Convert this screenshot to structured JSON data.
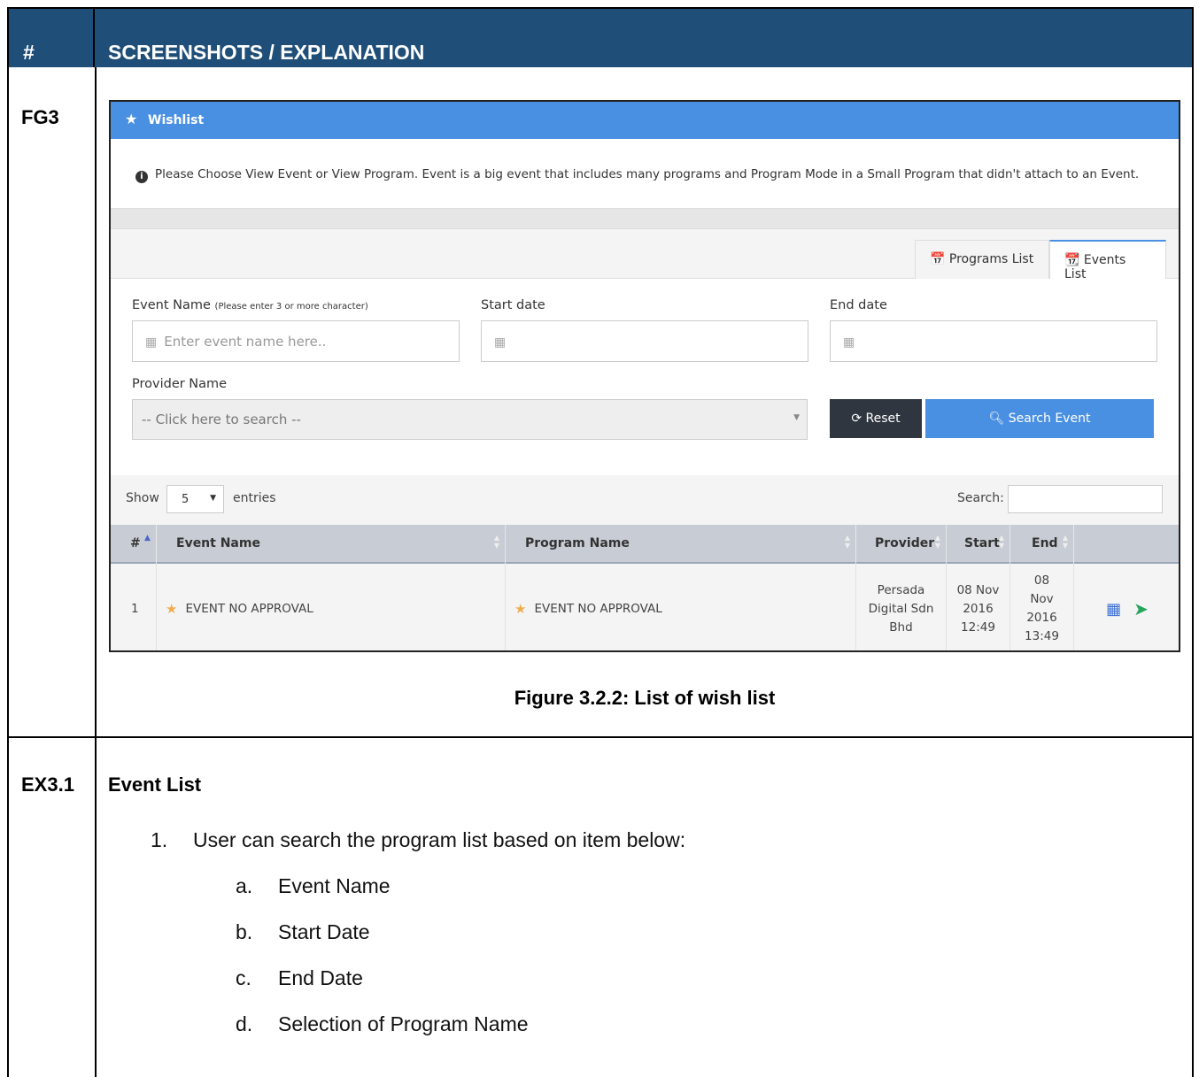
{
  "doc": {
    "header_hash": "#",
    "header_title": "SCREENSHOTS / EXPLANATION",
    "row1_id": "FG3",
    "figure_caption": "Figure 3.2.2: List of wish list",
    "row2_id": "EX3.1",
    "section_title": "Event List",
    "list_item_1": "1.",
    "list_item_1_text": "User can search the program list based on item below:",
    "sub_items": [
      {
        "marker": "a.",
        "text": "Event Name"
      },
      {
        "marker": "b.",
        "text": "Start Date"
      },
      {
        "marker": "c.",
        "text": "End Date"
      },
      {
        "marker": "d.",
        "text": "Selection of Program Name"
      }
    ]
  },
  "app": {
    "panel_title": "Wishlist",
    "notice": "Please Choose View Event or View Program. Event is a big event that includes many programs and Program Mode in a Small Program that didn't attach to an Event.",
    "tabs": {
      "programs": "Programs List",
      "events": "Events List"
    },
    "form": {
      "event_name_label": "Event Name",
      "event_name_hint": "(Please enter 3 or more character)",
      "event_name_placeholder": "Enter event name here..",
      "start_date_label": "Start date",
      "end_date_label": "End date",
      "provider_label": "Provider Name",
      "provider_placeholder": "-- Click here to search --",
      "reset_label": "Reset",
      "search_label": "Search Event"
    },
    "datatable": {
      "show_label": "Show",
      "length_value": "5",
      "entries_label": "entries",
      "search_label": "Search:",
      "columns": [
        "#",
        "Event Name",
        "Program Name",
        "Provider",
        "Start",
        "End"
      ],
      "rows": [
        {
          "num": "1",
          "event_name": "EVENT NO APPROVAL",
          "program_name": "EVENT NO APPROVAL",
          "provider": [
            "Persada",
            "Digital Sdn",
            "Bhd"
          ],
          "start": [
            "08 Nov",
            "2016",
            "12:49"
          ],
          "end": [
            "08",
            "Nov",
            "2016",
            "13:49"
          ]
        }
      ]
    },
    "colors": {
      "header_blue": "#1f4e79",
      "panel_blue": "#4a90e2",
      "star_orange": "#f0ad4e",
      "send_green": "#26a65b"
    }
  }
}
